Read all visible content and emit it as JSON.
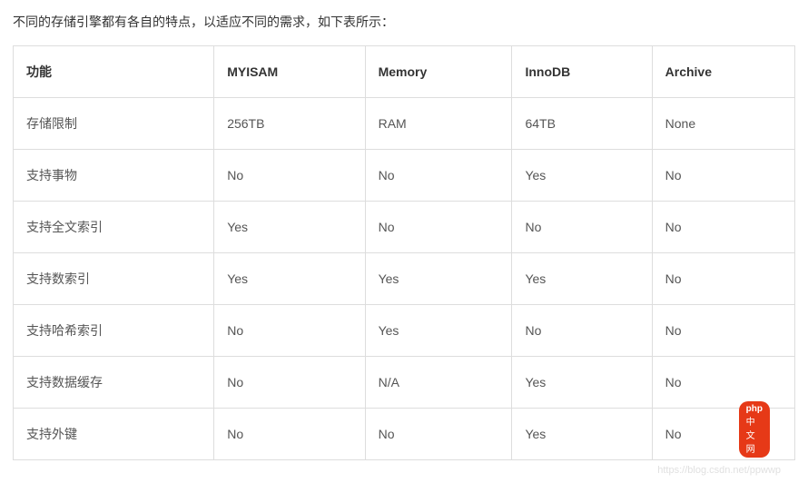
{
  "intro": "不同的存储引擎都有各自的特点，以适应不同的需求，如下表所示：",
  "chart_data": {
    "type": "table",
    "headers": [
      "功能",
      "MYISAM",
      "Memory",
      "InnoDB",
      "Archive"
    ],
    "rows": [
      [
        "存储限制",
        "256TB",
        "RAM",
        "64TB",
        "None"
      ],
      [
        "支持事物",
        "No",
        "No",
        "Yes",
        "No"
      ],
      [
        "支持全文索引",
        "Yes",
        "No",
        "No",
        "No"
      ],
      [
        "支持数索引",
        "Yes",
        "Yes",
        "Yes",
        "No"
      ],
      [
        "支持哈希索引",
        "No",
        "Yes",
        "No",
        "No"
      ],
      [
        "支持数据缓存",
        "No",
        "N/A",
        "Yes",
        "No"
      ],
      [
        "支持外键",
        "No",
        "No",
        "Yes",
        "No"
      ]
    ]
  },
  "watermark": "https://blog.csdn.net/ppwwp",
  "badge": {
    "logo": "php",
    "text": "中文网"
  }
}
